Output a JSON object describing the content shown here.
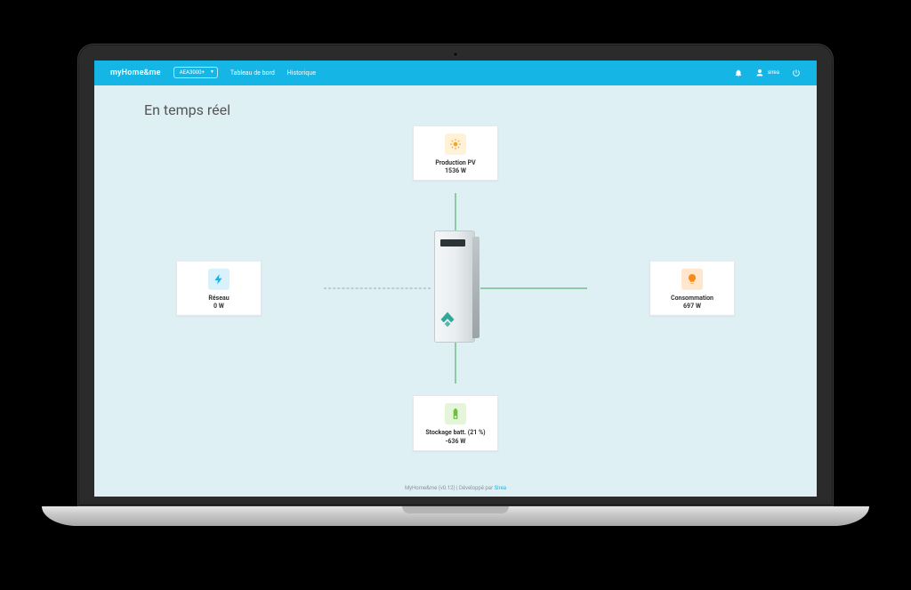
{
  "header": {
    "logo": "myHome&me",
    "device_selected": "AEA3000+",
    "nav": {
      "dashboard": "Tableau de bord",
      "history": "Historique"
    },
    "user": "sirea"
  },
  "page": {
    "title": "En temps réel"
  },
  "cards": {
    "pv": {
      "label": "Production PV",
      "value": "1536 W"
    },
    "grid": {
      "label": "Réseau",
      "value": "0 W"
    },
    "cons": {
      "label": "Consommation",
      "value": "697 W"
    },
    "batt": {
      "label": "Stockage batt. (21 %)",
      "value": "-636 W"
    }
  },
  "footer": {
    "text_prefix": "MyHome&me (v0.12) | Développé par ",
    "link": "Sirea"
  }
}
